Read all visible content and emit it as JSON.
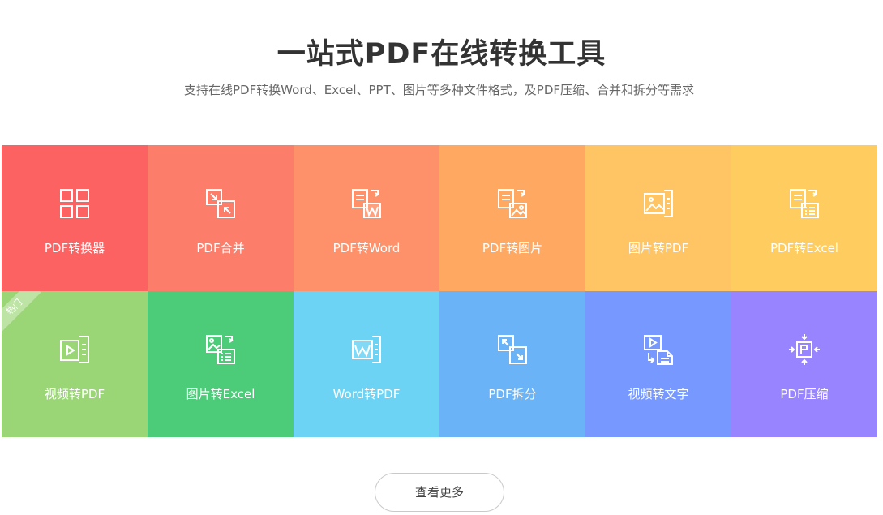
{
  "header": {
    "title": "一站式PDF在线转换工具",
    "subtitle": "支持在线PDF转换Word、Excel、PPT、图片等多种文件格式，及PDF压缩、合并和拆分等需求"
  },
  "tools": [
    {
      "label": "PDF转换器",
      "icon": "grid-icon",
      "color": "#fc6262"
    },
    {
      "label": "PDF合并",
      "icon": "merge-icon",
      "color": "#fd7d6b"
    },
    {
      "label": "PDF转Word",
      "icon": "doc-to-word-icon",
      "color": "#fe9169"
    },
    {
      "label": "PDF转图片",
      "icon": "doc-to-image-icon",
      "color": "#ffa862"
    },
    {
      "label": "图片转PDF",
      "icon": "image-to-doc-icon",
      "color": "#ffc463"
    },
    {
      "label": "PDF转Excel",
      "icon": "doc-to-excel-icon",
      "color": "#ffcd5f"
    },
    {
      "label": "视频转PDF",
      "icon": "video-to-doc-icon",
      "color": "#9ad676",
      "badge": "热门"
    },
    {
      "label": "图片转Excel",
      "icon": "image-to-excel-icon",
      "color": "#4ccc78"
    },
    {
      "label": "Word转PDF",
      "icon": "word-to-doc-icon",
      "color": "#6dd3f4"
    },
    {
      "label": "PDF拆分",
      "icon": "split-icon",
      "color": "#6bb3f7"
    },
    {
      "label": "视频转文字",
      "icon": "video-to-text-icon",
      "color": "#7698ff"
    },
    {
      "label": "PDF压缩",
      "icon": "compress-icon",
      "color": "#9884fe"
    }
  ],
  "more_button": {
    "label": "查看更多"
  }
}
